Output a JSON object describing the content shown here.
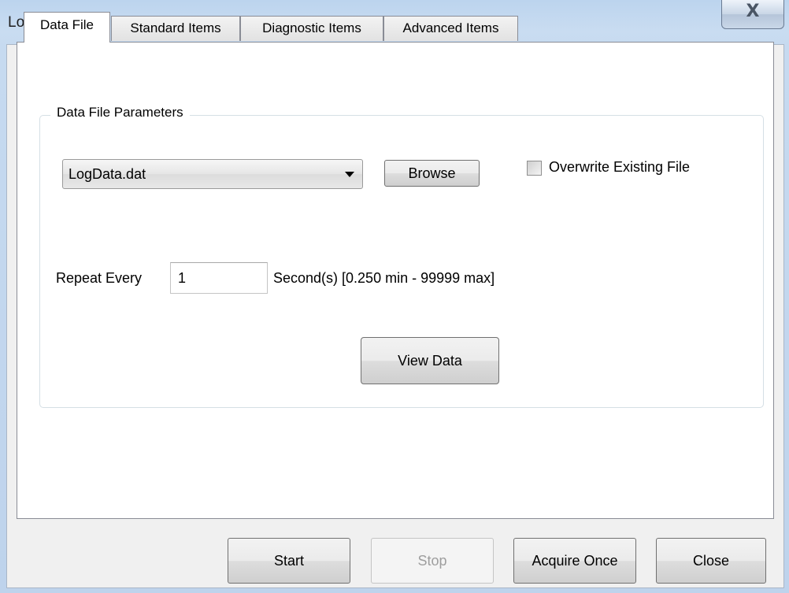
{
  "window": {
    "title": "Log Data",
    "close_symbol": "X"
  },
  "tabs": [
    {
      "label": "Data File",
      "active": true
    },
    {
      "label": "Standard Items",
      "active": false
    },
    {
      "label": "Diagnostic Items",
      "active": false
    },
    {
      "label": "Advanced Items",
      "active": false
    }
  ],
  "data_file": {
    "group_title": "Data File Parameters",
    "file_select": {
      "selected": "LogData.dat"
    },
    "browse_label": "Browse",
    "overwrite": {
      "label": "Overwrite Existing File",
      "checked": false
    },
    "repeat": {
      "label": "Repeat Every",
      "value": "1",
      "range_text": "Second(s) [0.250 min - 99999 max]"
    },
    "view_data_label": "View Data"
  },
  "footer": {
    "start_label": "Start",
    "stop_label": "Stop",
    "stop_disabled": true,
    "acquire_once_label": "Acquire Once",
    "close_label": "Close"
  }
}
